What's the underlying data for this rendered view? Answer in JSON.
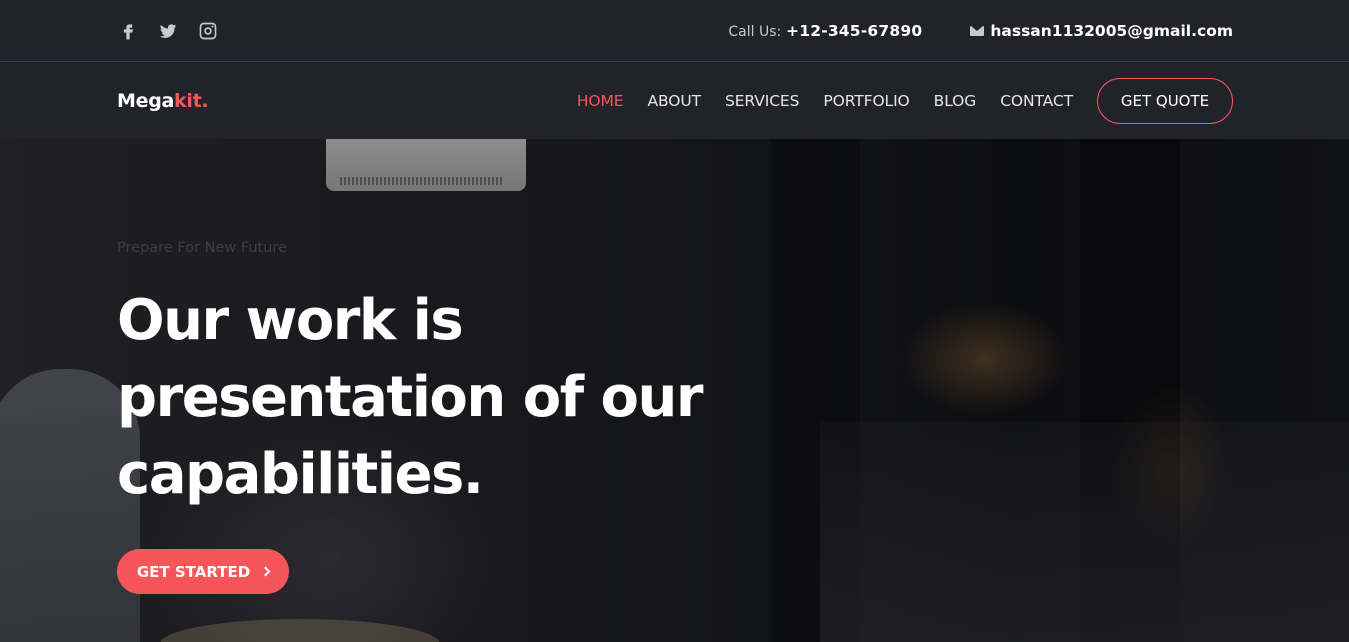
{
  "topbar": {
    "socials": [
      "facebook-icon",
      "twitter-icon",
      "instagram-icon"
    ],
    "call_label": "Call Us:",
    "phone": "+12-345-67890",
    "email": "hassan1132005@gmail.com"
  },
  "navbar": {
    "logo_main": "Mega",
    "logo_accent": "kit.",
    "items": [
      {
        "label": "HOME",
        "active": true
      },
      {
        "label": "ABOUT"
      },
      {
        "label": "SERVICES"
      },
      {
        "label": "PORTFOLIO"
      },
      {
        "label": "BLOG"
      },
      {
        "label": "CONTACT"
      }
    ],
    "quote_label": "GET QUOTE"
  },
  "hero": {
    "kicker": "Prepare For New Future",
    "headline": "Our work is presentation of our capabilities.",
    "cta_label": "GET STARTED"
  },
  "colors": {
    "accent": "#f6555a",
    "dark": "#22232a"
  }
}
